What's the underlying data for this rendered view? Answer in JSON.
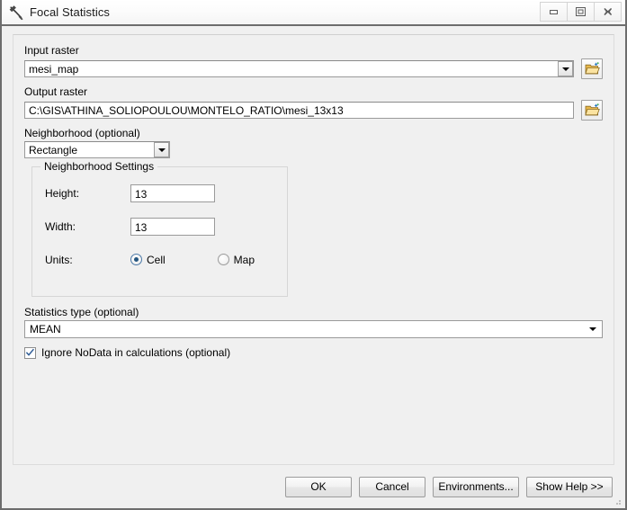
{
  "window": {
    "title": "Focal Statistics",
    "icon": "hammer-tool-icon",
    "controls": {
      "minimize": "minimize-icon",
      "maximize": "maximize-icon",
      "close": "close-icon"
    }
  },
  "form": {
    "input_raster": {
      "label": "Input raster",
      "value": "mesi_map",
      "browse_icon": "open-folder-icon"
    },
    "output_raster": {
      "label": "Output raster",
      "value": "C:\\GIS\\ATHINA_SOLIOPOULOU\\MONTELO_RATIO\\mesi_13x13",
      "browse_icon": "open-folder-icon"
    },
    "neighborhood": {
      "label": "Neighborhood (optional)",
      "value": "Rectangle"
    },
    "neighborhood_settings": {
      "legend": "Neighborhood Settings",
      "height_label": "Height:",
      "height_value": "13",
      "width_label": "Width:",
      "width_value": "13",
      "units_label": "Units:",
      "unit_cell": "Cell",
      "unit_map": "Map",
      "unit_selected": "Cell"
    },
    "statistics_type": {
      "label": "Statistics type (optional)",
      "value": "MEAN"
    },
    "ignore_nodata": {
      "label": "Ignore NoData in calculations (optional)",
      "checked": true
    }
  },
  "buttons": {
    "ok": "OK",
    "cancel": "Cancel",
    "environments": "Environments...",
    "help": "Show Help >>"
  },
  "colors": {
    "dialog_bg": "#f0f0f0",
    "frame": "#6d6d6d",
    "field_bg": "#ffffff",
    "radio_accent": "#24557f",
    "check_accent": "#2f5c95",
    "folder_icon": "#f0c14b"
  }
}
